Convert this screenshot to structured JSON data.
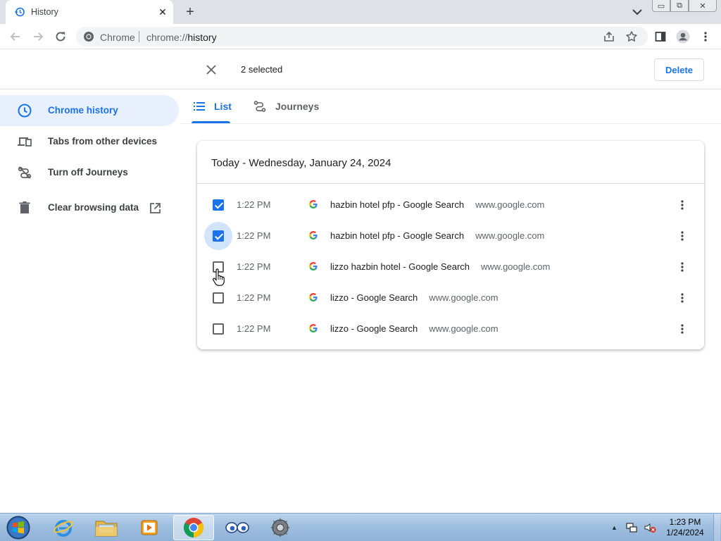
{
  "browser": {
    "tab_title": "History",
    "tab_close": "✕",
    "new_tab": "+",
    "min": "▭",
    "max": "⧉",
    "close": "✕",
    "omnibox_chip": "Chrome",
    "omnibox_scheme": "chrome://",
    "omnibox_host": "history"
  },
  "selection": {
    "count_label": "2 selected",
    "delete_label": "Delete"
  },
  "sidebar": {
    "items": [
      {
        "label": "Chrome history",
        "icon": "clock-icon"
      },
      {
        "label": "Tabs from other devices",
        "icon": "devices-icon"
      },
      {
        "label": "Turn off Journeys",
        "icon": "journeys-off-icon"
      },
      {
        "label": "Clear browsing data",
        "icon": "trash-icon"
      }
    ]
  },
  "view_tabs": [
    {
      "label": "List",
      "icon": "list-icon"
    },
    {
      "label": "Journeys",
      "icon": "journeys-icon"
    }
  ],
  "history": {
    "date_header": "Today - Wednesday, January 24, 2024",
    "rows": [
      {
        "time": "1:22 PM",
        "title": "hazbin hotel pfp - Google Search",
        "domain": "www.google.com",
        "checked": true
      },
      {
        "time": "1:22 PM",
        "title": "hazbin hotel pfp - Google Search",
        "domain": "www.google.com",
        "checked": true
      },
      {
        "time": "1:22 PM",
        "title": "lizzo hazbin hotel - Google Search",
        "domain": "www.google.com",
        "checked": false
      },
      {
        "time": "1:22 PM",
        "title": "lizzo - Google Search",
        "domain": "www.google.com",
        "checked": false
      },
      {
        "time": "1:22 PM",
        "title": "lizzo - Google Search",
        "domain": "www.google.com",
        "checked": false
      }
    ]
  },
  "taskbar": {
    "time": "1:23 PM",
    "date": "1/24/2024"
  },
  "colors": {
    "accent": "#1a73e8",
    "active_bg": "#e8f0fe"
  }
}
